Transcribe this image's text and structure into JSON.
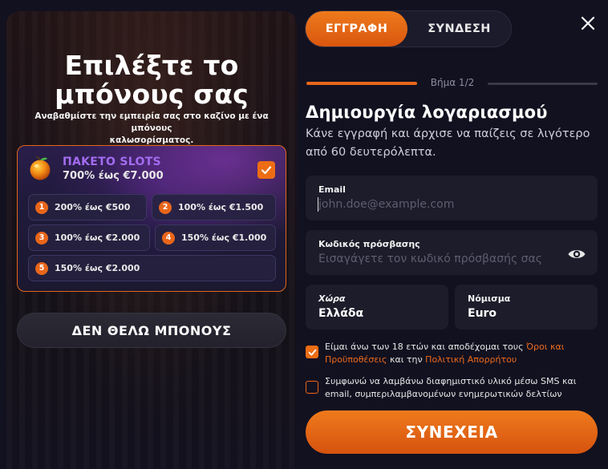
{
  "promo": {
    "title_line1": "Επιλέξτε το",
    "title_line2": "μπόνους σας",
    "subtitle_line1": "Αναβαθμίστε την εμπειρία σας στο καζίνο με ένα μπόνους",
    "subtitle_line2": "καλωσορίσματος.",
    "package": {
      "name": "ΠΑΚΕΤΟ SLOTS",
      "total": "700% έως €7.000",
      "selected": true,
      "icon": "fruit-icon"
    },
    "tiers": [
      {
        "num": "1",
        "label": "200% έως €500"
      },
      {
        "num": "2",
        "label": "100% έως €1.500"
      },
      {
        "num": "3",
        "label": "100% έως €2.000"
      },
      {
        "num": "4",
        "label": "150% έως €1.000"
      },
      {
        "num": "5",
        "label": "150% έως €2.000"
      }
    ],
    "no_bonus_label": "ΔΕΝ ΘΕΛΩ ΜΠΟΝΟΥΣ"
  },
  "tabs": {
    "signup": "ΕΓΓΡΑΦΗ",
    "login": "ΣΥΝΔΕΣΗ",
    "active": "signup"
  },
  "progress": {
    "step_label": "Βήμα 1/2",
    "current": 1,
    "total": 2
  },
  "form": {
    "title": "Δημιουργία λογαριασμού",
    "subtitle": "Κάνε εγγραφή και άρχισε να παίζεις σε λιγότερο από 60 δευτερόλεπτα.",
    "email": {
      "label": "Email",
      "placeholder": "john.doe@example.com",
      "value": ""
    },
    "password": {
      "label": "Κωδικός πρόσβασης",
      "placeholder": "Εισαγάγετε τον κωδικό πρόσβασής σας",
      "value": ""
    },
    "country": {
      "label": "Χώρα",
      "value": "Ελλάδα"
    },
    "currency": {
      "label": "Νόμισμα",
      "value": "Euro"
    },
    "terms": {
      "checked": true,
      "text_before": "Είμαι άνω των 18 ετών και αποδέχομαι τους ",
      "terms_link": "Όροι και Προϋποθέσεις",
      "text_middle": " και την ",
      "privacy_link": "Πολιτική Απορρήτου"
    },
    "marketing": {
      "checked": false,
      "text": "Συμφωνώ να λαμβάνω διαφημιστικό υλικό μέσω SMS και email, συμπεριλαμβανομένων ενημερωτικών δελτίων"
    },
    "continue_label": "ΣΥΝΕΧΕΙΑ"
  },
  "colors": {
    "accent": "#ec6d14",
    "background": "#121120",
    "field": "#1d1c2a",
    "package_name": "#a36cf0"
  }
}
